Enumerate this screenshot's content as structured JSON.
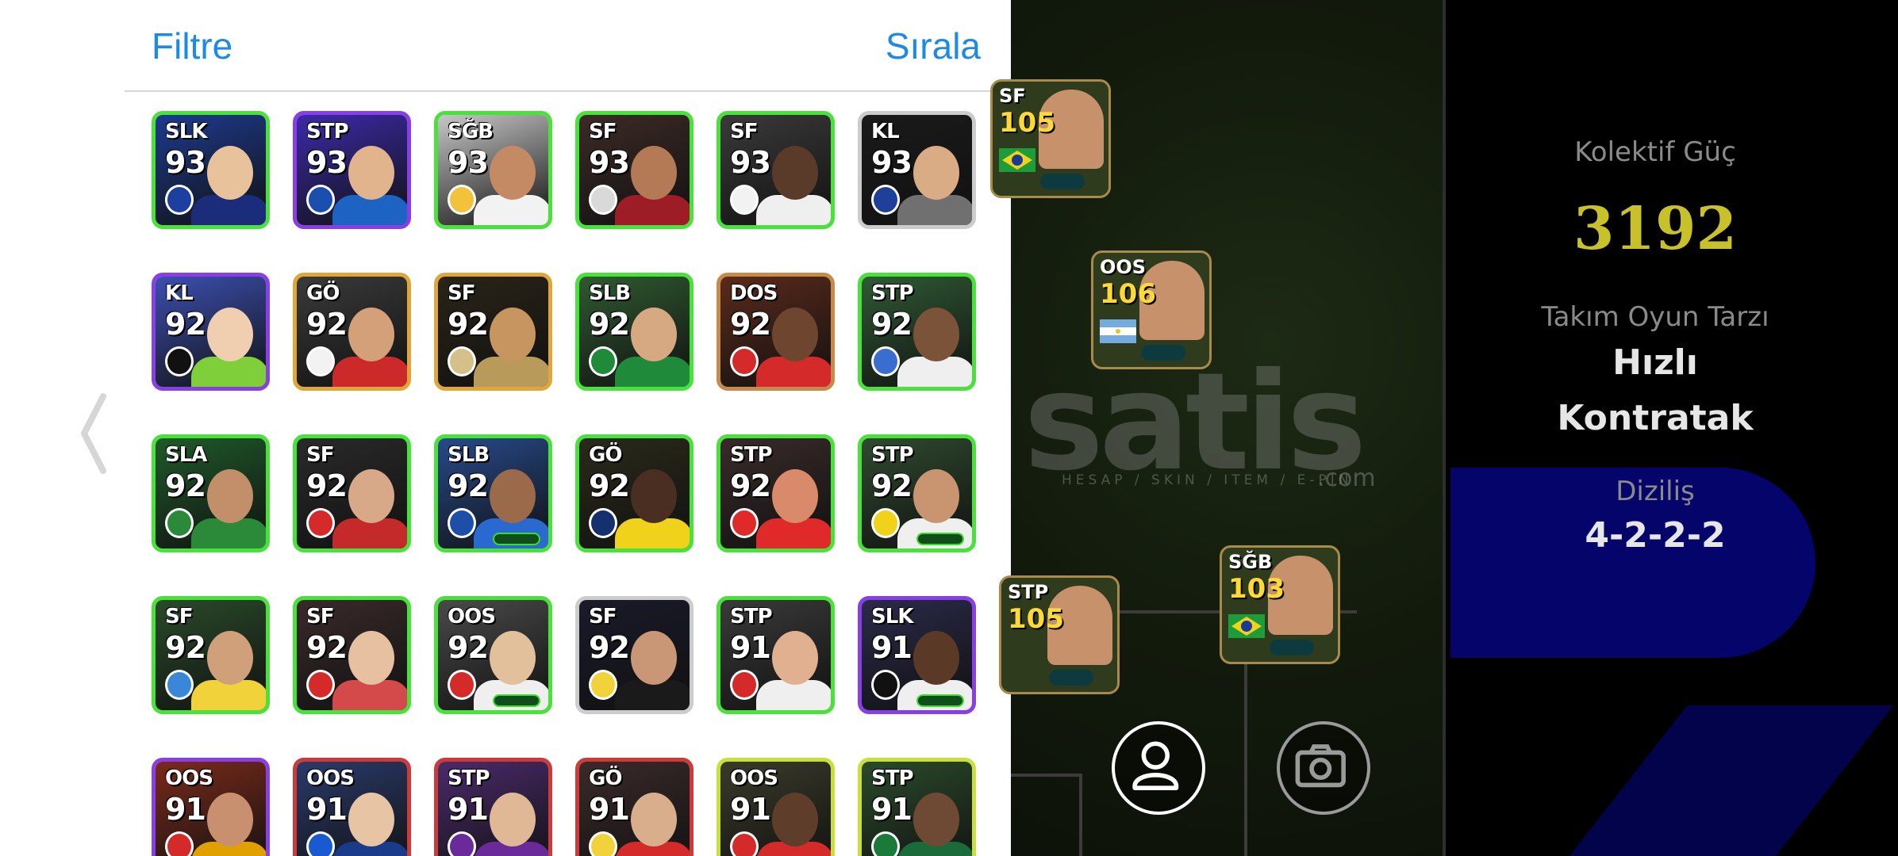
{
  "panel": {
    "filter_label": "Filtre",
    "sort_label": "Sırala"
  },
  "cards": [
    {
      "pos": "SLK",
      "rating": "93",
      "border": "#48e23a",
      "bg": "#1d3a8e",
      "skin": "#e8c29a",
      "kit": "#1a2c7a",
      "badge": "#1d3fa0"
    },
    {
      "pos": "STP",
      "rating": "93",
      "border": "#8a3ee6",
      "bg": "#3b2aa8",
      "skin": "#e2b48d",
      "kit": "#1d63c4",
      "badge": "#1a4fb0"
    },
    {
      "pos": "SĞB",
      "rating": "93",
      "border": "#48e23a",
      "bg": "#c7c7c7",
      "skin": "#c48a64",
      "kit": "#f2f2f2",
      "badge": "#f1c23a"
    },
    {
      "pos": "SF",
      "rating": "93",
      "border": "#48e23a",
      "bg": "#3c2a26",
      "skin": "#b47a55",
      "kit": "#9d1c25",
      "badge": "#d9d9d9"
    },
    {
      "pos": "SF",
      "rating": "93",
      "border": "#48e23a",
      "bg": "#3a3a3a",
      "skin": "#5a3a28",
      "kit": "#efefef",
      "badge": "#f2f2f2"
    },
    {
      "pos": "KL",
      "rating": "93",
      "border": "#cccccc",
      "bg": "#1a1a1a",
      "skin": "#d9ac86",
      "kit": "#707070",
      "badge": "#1e3f9a"
    },
    {
      "pos": "KL",
      "rating": "92",
      "border": "#8a3ee6",
      "bg": "#3c4fb0",
      "skin": "#f0cfb0",
      "kit": "#7fcf3a",
      "badge": "#111111"
    },
    {
      "pos": "GÖ",
      "rating": "92",
      "border": "#e0a63a",
      "bg": "#3a3a3a",
      "skin": "#d4a07a",
      "kit": "#cc2a2a",
      "badge": "#f2f2f2"
    },
    {
      "pos": "SF",
      "rating": "92",
      "border": "#e0a63a",
      "bg": "#2a2418",
      "skin": "#c7955f",
      "kit": "#b89a5a",
      "badge": "#d6c08a"
    },
    {
      "pos": "SLB",
      "rating": "92",
      "border": "#48e23a",
      "bg": "#2f5a30",
      "skin": "#d6a983",
      "kit": "#1f8a3a",
      "badge": "#1f8a3a"
    },
    {
      "pos": "DOS",
      "rating": "92",
      "border": "#c78a4a",
      "bg": "#5a2a1a",
      "skin": "#6e4630",
      "kit": "#d42a2a",
      "badge": "#d42a2a"
    },
    {
      "pos": "STP",
      "rating": "92",
      "border": "#48e23a",
      "bg": "#2f5a34",
      "skin": "#7a5338",
      "kit": "#efefef",
      "badge": "#3a6dd0"
    },
    {
      "pos": "SLA",
      "rating": "92",
      "border": "#48e23a",
      "bg": "#1f5a2a",
      "skin": "#c38f6a",
      "kit": "#2a8a3a",
      "badge": "#2a8a3a"
    },
    {
      "pos": "SF",
      "rating": "92",
      "border": "#48e23a",
      "bg": "#2a2a2a",
      "skin": "#d8a988",
      "kit": "#c42a2a",
      "badge": "#d42a2a"
    },
    {
      "pos": "SLB",
      "rating": "92",
      "border": "#48e23a",
      "bg": "#274a8a",
      "skin": "#9a6a4a",
      "kit": "#2a6ad0",
      "badge": "#1e4fa8"
    },
    {
      "pos": "GÖ",
      "rating": "92",
      "border": "#48e23a",
      "bg": "#2a2a1a",
      "skin": "#4a2e22",
      "kit": "#f0d21a",
      "badge": "#14306e"
    },
    {
      "pos": "STP",
      "rating": "92",
      "border": "#48e23a",
      "bg": "#3a2a2a",
      "skin": "#d98a6a",
      "kit": "#e02a2a",
      "badge": "#e02a2a"
    },
    {
      "pos": "STP",
      "rating": "92",
      "border": "#48e23a",
      "bg": "#2f4a2f",
      "skin": "#c99470",
      "kit": "#efefef",
      "badge": "#f0d21a"
    },
    {
      "pos": "SF",
      "rating": "92",
      "border": "#48e23a",
      "bg": "#2a4a2a",
      "skin": "#d0a07a",
      "kit": "#f2d23a",
      "badge": "#3a86d8"
    },
    {
      "pos": "SF",
      "rating": "92",
      "border": "#48e23a",
      "bg": "#3a2a2a",
      "skin": "#e6c0a0",
      "kit": "#d44a4a",
      "badge": "#d42a2a"
    },
    {
      "pos": "OOS",
      "rating": "92",
      "border": "#48e23a",
      "bg": "#4a4a4a",
      "skin": "#e2c09c",
      "kit": "#efefef",
      "badge": "#d42a2a"
    },
    {
      "pos": "SF",
      "rating": "92",
      "border": "#cccccc",
      "bg": "#1a1a2a",
      "skin": "#c99676",
      "kit": "#1a1a1a",
      "badge": "#f2d23a"
    },
    {
      "pos": "STP",
      "rating": "91",
      "border": "#48e23a",
      "bg": "#3a3a3a",
      "skin": "#e0b090",
      "kit": "#efefef",
      "badge": "#d42a2a"
    },
    {
      "pos": "SLK",
      "rating": "91",
      "border": "#8a3ee6",
      "bg": "#2a2a4a",
      "skin": "#5a3a26",
      "kit": "#efefef",
      "badge": "#111111"
    },
    {
      "pos": "OOS",
      "rating": "91",
      "border": "#8a3ee6",
      "bg": "#7a2a1a",
      "skin": "#c99070",
      "kit": "#e0a000",
      "badge": "#d42a2a"
    },
    {
      "pos": "OOS",
      "rating": "91",
      "border": "#cc3a3a",
      "bg": "#2a3a6a",
      "skin": "#e6c4a4",
      "kit": "#1a3a8a",
      "badge": "#1a5ad0"
    },
    {
      "pos": "STP",
      "rating": "91",
      "border": "#cc3a3a",
      "bg": "#4a2a6a",
      "skin": "#e0b896",
      "kit": "#6a2a9a",
      "badge": "#6a2a9a"
    },
    {
      "pos": "GÖ",
      "rating": "91",
      "border": "#cc3a3a",
      "bg": "#3a2a2a",
      "skin": "#d8ae8c",
      "kit": "#d42a2a",
      "badge": "#f2d23a"
    },
    {
      "pos": "OOS",
      "rating": "91",
      "border": "#c9e03a",
      "bg": "#3a3a2a",
      "skin": "#5e3e2a",
      "kit": "#d42a2a",
      "badge": "#d42a2a"
    },
    {
      "pos": "STP",
      "rating": "91",
      "border": "#c9e03a",
      "bg": "#2a4a2a",
      "skin": "#6e4a34",
      "kit": "#1a6a3a",
      "badge": "#1a7a3a"
    }
  ],
  "pitch_cards": [
    {
      "pos": "SF",
      "rating": "105",
      "flag": "brazil"
    },
    {
      "pos": "OOS",
      "rating": "106",
      "flag": "argentina"
    },
    {
      "pos": "STP",
      "rating": "105",
      "flag": "none"
    },
    {
      "pos": "SĞB",
      "rating": "103",
      "flag": "brazil"
    }
  ],
  "watermark": {
    "main": "satis",
    "sub": "HESAP / SKIN / ITEM / E-PIN",
    "suffix": ".com"
  },
  "stats": {
    "power_label": "Kolektif Güç",
    "power_value": "3192",
    "style_label": "Takım Oyun Tarzı",
    "style_line1": "Hızlı",
    "style_line2": "Kontratak",
    "formation_label": "Diziliş",
    "formation_value": "4-2-2-2"
  },
  "icons": {
    "back": "chevron-left-icon",
    "profile": "user-icon",
    "camera": "camera-icon"
  }
}
